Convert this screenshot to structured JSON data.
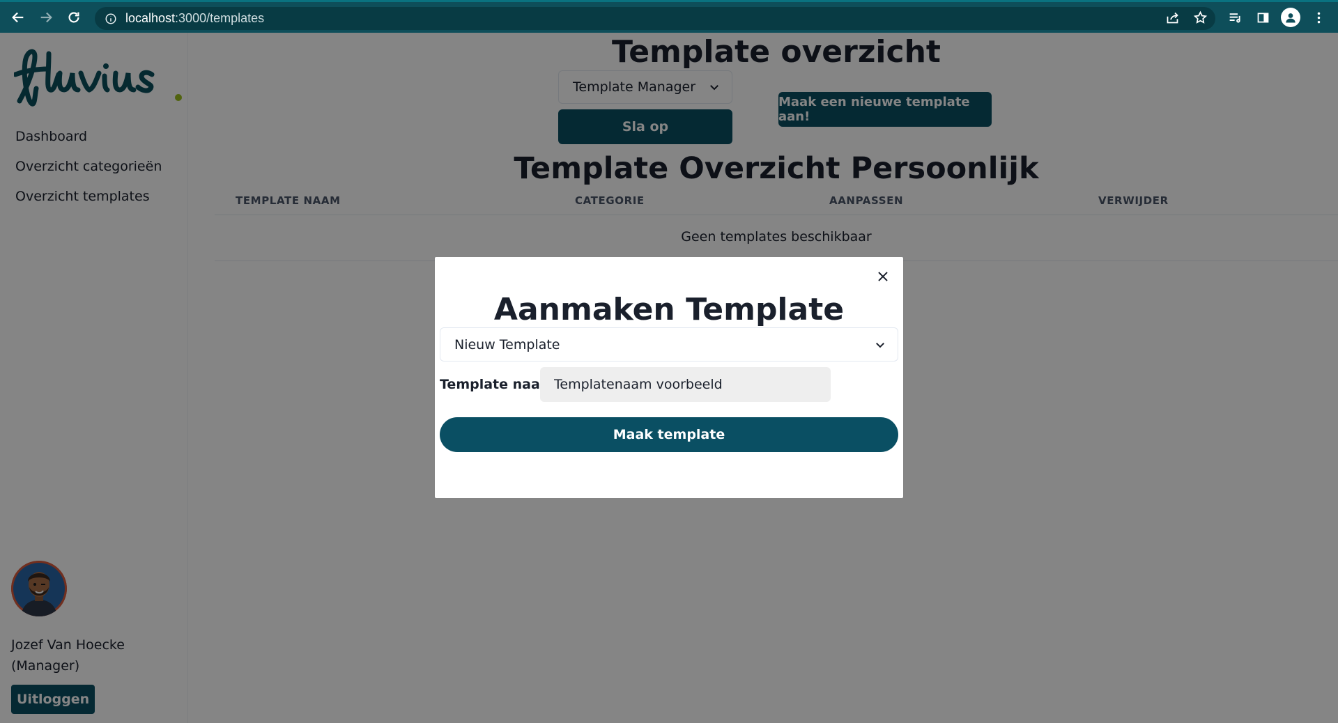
{
  "browser": {
    "url_host": "localhost",
    "url_path": ":3000/templates"
  },
  "brand": {
    "logo_text": "fluvius",
    "logo_color": "#0b4f5c",
    "dot_color": "#9bbf1e"
  },
  "sidebar": {
    "items": [
      {
        "label": "Dashboard"
      },
      {
        "label": "Overzicht categorieën"
      },
      {
        "label": "Overzicht templates"
      }
    ],
    "user": {
      "name": "Jozef Van Hoecke",
      "role": "(Manager)"
    },
    "logout_label": "Uitloggen"
  },
  "main": {
    "title": "Template overzicht",
    "select_value": "Template Manager",
    "save_label": "Sla op",
    "new_template_label": "Maak een nieuwe template aan!",
    "subtitle": "Template Overzicht Persoonlijk",
    "table": {
      "headers": [
        "TEMPLATE NAAM",
        "CATEGORIE",
        "AANPASSEN",
        "VERWIJDER"
      ],
      "empty_text": "Geen templates beschikbaar"
    }
  },
  "modal": {
    "title": "Aanmaken Template",
    "select_value": "Nieuw Template",
    "name_label": "Template naam:",
    "name_value": "Templatenaam voorbeeld",
    "create_label": "Maak template"
  },
  "colors": {
    "primary": "#0a4f63",
    "chrome": "#0e4e5a"
  }
}
